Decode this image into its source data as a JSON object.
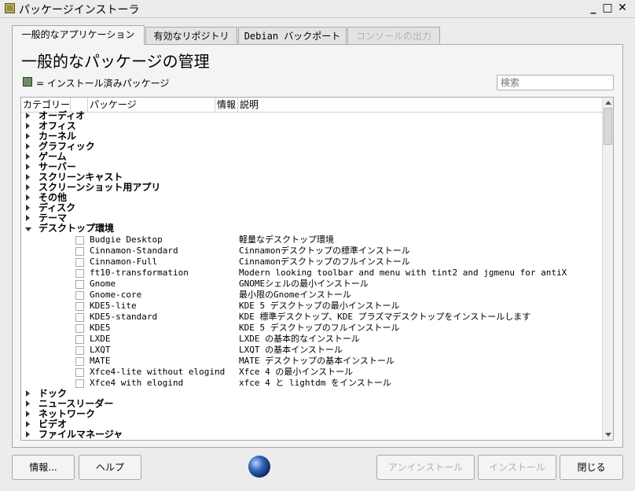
{
  "window": {
    "title": "パッケージインストーラ",
    "controls": [
      "_",
      "□",
      "✕"
    ]
  },
  "tabs": [
    {
      "label": "一般的なアプリケーション",
      "state": "active"
    },
    {
      "label": "有効なリポジトリ",
      "state": "normal"
    },
    {
      "label": "Debian バックポート",
      "state": "normal"
    },
    {
      "label": "コンソールの出力",
      "state": "disabled"
    }
  ],
  "heading": "一般的なパッケージの管理",
  "legend": {
    "color": "#6b8e62",
    "text": "= インストール済みパッケージ"
  },
  "search": {
    "placeholder": "検索",
    "value": ""
  },
  "tree": {
    "columns": [
      "カテゴリー",
      "パッケージ",
      "情報",
      "説明"
    ],
    "categories_before": [
      "オーディオ",
      "オフィス",
      "カーネル",
      "グラフィック",
      "ゲーム",
      "サーバー",
      "スクリーンキャスト",
      "スクリーンショット用アプリ",
      "その他",
      "ディスク",
      "テーマ"
    ],
    "expanded_category": "デスクトップ環境",
    "packages": [
      {
        "name": "Budgie Desktop",
        "description": "軽量なデスクトップ環境"
      },
      {
        "name": "Cinnamon-Standard",
        "description": "Cinnamonデスクトップの標準インストール"
      },
      {
        "name": "Cinnamon-Full",
        "description": "Cinnamonデスクトップのフルインストール"
      },
      {
        "name": "ft10-transformation",
        "description": "Modern looking toolbar and menu with tint2 and jgmenu for antiX"
      },
      {
        "name": "Gnome",
        "description": "GNOMEシェルの最小インストール"
      },
      {
        "name": "Gnome-core",
        "description": "最小限のGnomeインストール"
      },
      {
        "name": "KDE5-lite",
        "description": "KDE 5 デスクトップの最小インストール"
      },
      {
        "name": "KDE5-standard",
        "description": "KDE 標準デスクトップ、KDE プラズマデスクトップをインストールします"
      },
      {
        "name": "KDE5",
        "description": "KDE 5 デスクトップのフルインストール"
      },
      {
        "name": "LXDE",
        "description": "LXDE の基本的なインストール"
      },
      {
        "name": "LXQT",
        "description": "LXQT の基本インストール"
      },
      {
        "name": "MATE",
        "description": "MATE デスクトップの基本インストール"
      },
      {
        "name": "Xfce4-lite without elogind",
        "description": "Xfce 4 の最小インストール"
      },
      {
        "name": "Xfce4 with elogind",
        "description": "xfce 4 と lightdm をインストール"
      }
    ],
    "categories_after": [
      "ドック",
      "ニュースリーダー",
      "ネットワーク",
      "ビデオ",
      "ファイルマネージャ"
    ]
  },
  "buttons": {
    "info": "情報...",
    "help": "ヘルプ",
    "uninstall": "アンインストール",
    "install": "インストール",
    "close": "閉じる"
  }
}
